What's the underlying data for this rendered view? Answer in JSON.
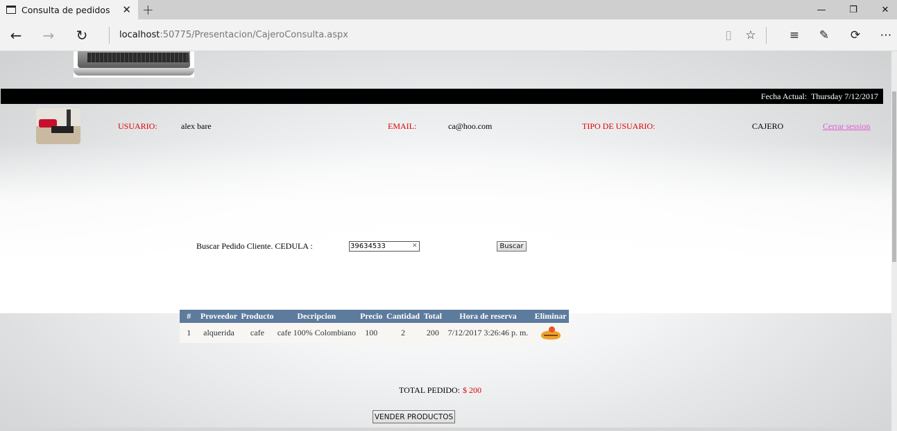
{
  "browser": {
    "tab_title": "Consulta de pedidos",
    "url_host": "localhost",
    "url_rest": ":50775/Presentacion/CajeroConsulta.aspx"
  },
  "header": {
    "date_label": "Fecha Actual:",
    "date_value": "Thursday 7/12/2017"
  },
  "user_info": {
    "usuario_label": "USUARIO:",
    "usuario_value": "alex bare",
    "email_label": "EMAIL:",
    "email_value": "ca@hoo.com",
    "tipo_label": "TIPO DE USUARIO:",
    "tipo_value": "CAJERO",
    "logout_label": "Cerrar session"
  },
  "search": {
    "label": "Buscar Pedido Cliente. CEDULA :",
    "value": "39634533",
    "button_label": "Buscar"
  },
  "orders_table": {
    "columns": [
      "#",
      "Proveedor",
      "Producto",
      "Decripcion",
      "Precio",
      "Cantidad",
      "Total",
      "Hora de reserva",
      "Eliminar"
    ],
    "rows": [
      {
        "num": "1",
        "proveedor": "alquerida",
        "producto": "cafe",
        "descripcion": "cafe 100% Colombiano",
        "precio": "100",
        "cantidad": "2",
        "total": "200",
        "hora": "7/12/2017 3:26:46 p. m.",
        "eliminar_icon": "delete-icon"
      }
    ]
  },
  "total": {
    "label": "TOTAL PEDIDO:",
    "value": "$ 200"
  },
  "actions": {
    "sell_button": "VENDER PRODUCTOS"
  }
}
